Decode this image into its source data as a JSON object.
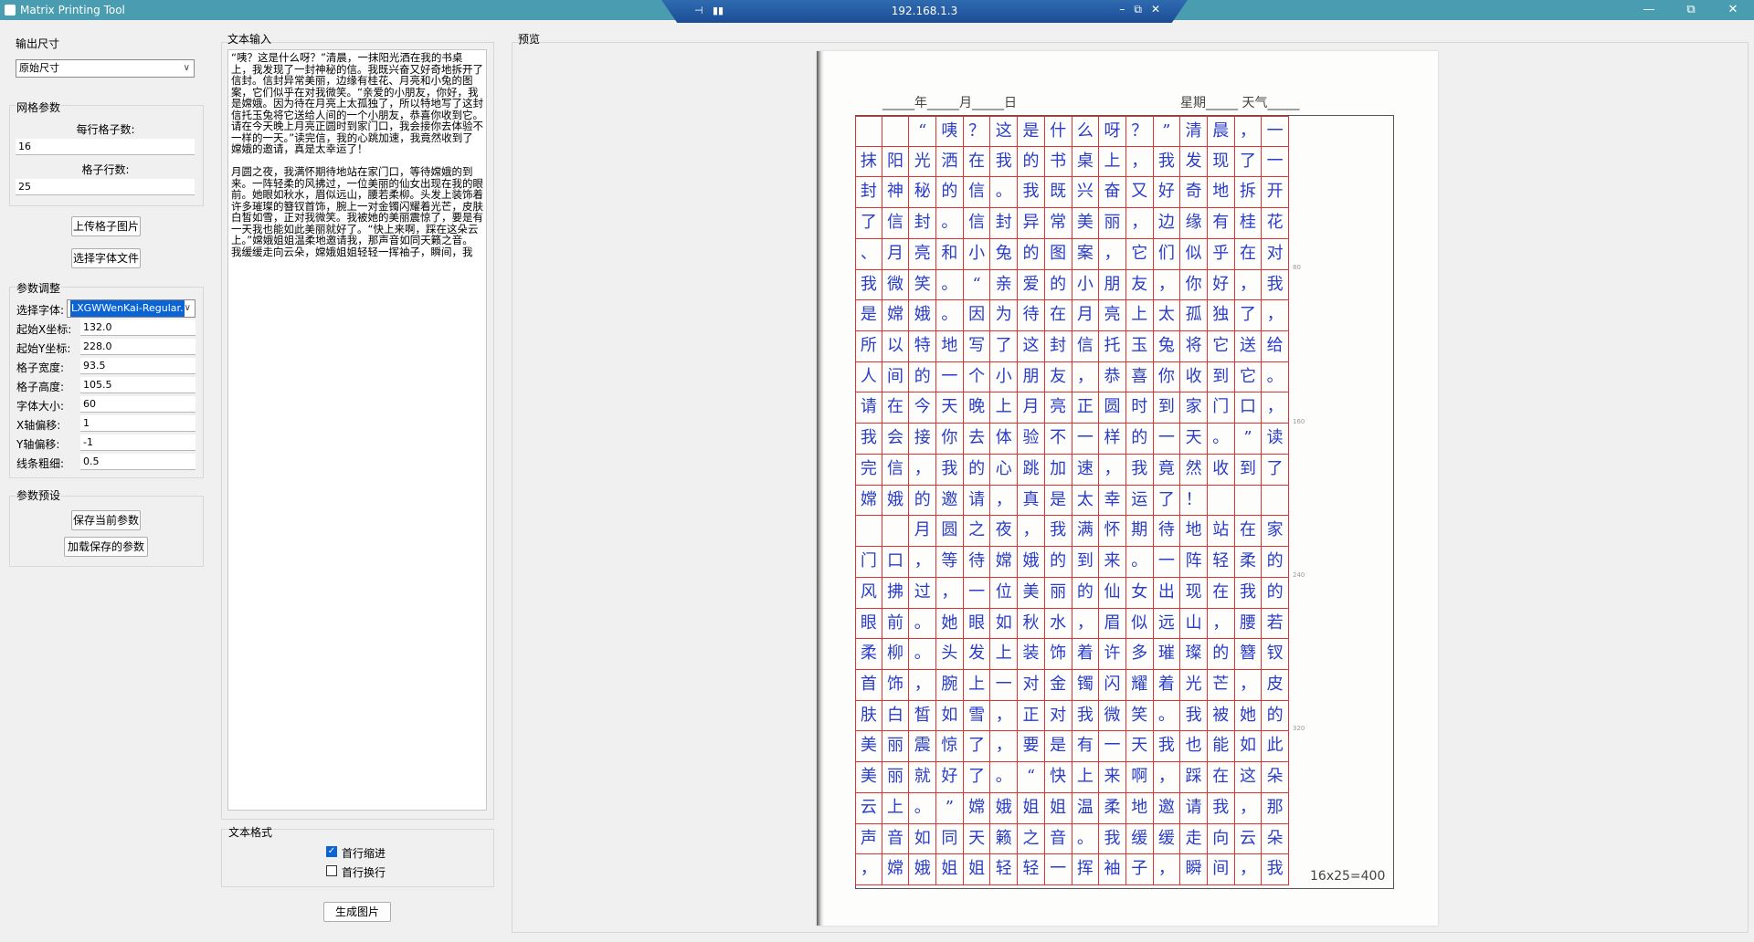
{
  "window": {
    "title": "Matrix Printing Tool",
    "remote_host": "192.168.1.3"
  },
  "output_size": {
    "group_label": "输出尺寸",
    "selected": "原始尺寸"
  },
  "grid_params": {
    "group_label": "网格参数",
    "per_row_label": "每行格子数:",
    "per_row_value": "16",
    "rows_label": "格子行数:",
    "rows_value": "25"
  },
  "buttons": {
    "upload_grid": "上传格子图片",
    "select_font_file": "选择字体文件",
    "save_params": "保存当前参数",
    "load_params": "加载保存的参数",
    "generate": "生成图片"
  },
  "param_adjust": {
    "group_label": "参数调整",
    "rows": [
      {
        "label": "选择字体:",
        "value": "LXGWWenKai-Regular."
      },
      {
        "label": "起始X坐标:",
        "value": "132.0"
      },
      {
        "label": "起始Y坐标:",
        "value": "228.0"
      },
      {
        "label": "格子宽度:",
        "value": "93.5"
      },
      {
        "label": "格子高度:",
        "value": "105.5"
      },
      {
        "label": "字体大小:",
        "value": "60"
      },
      {
        "label": "X轴偏移:",
        "value": "1"
      },
      {
        "label": "Y轴偏移:",
        "value": "-1"
      },
      {
        "label": "线条粗细:",
        "value": "0.5"
      }
    ]
  },
  "presets": {
    "group_label": "参数预设"
  },
  "text_input": {
    "label": "文本输入",
    "content": "“咦？这是什么呀？”清晨，一抹阳光洒在我的书桌上，我发现了一封神秘的信。我既兴奋又好奇地拆开了信封。信封异常美丽，边缘有桂花、月亮和小兔的图案，它们似乎在对我微笑。“亲爱的小朋友，你好，我是嫦娥。因为待在月亮上太孤独了，所以特地写了这封信托玉兔将它送给人间的一个小朋友，恭喜你收到它。请在今天晚上月亮正圆时到家门口，我会接你去体验不一样的一天。”读完信，我的心跳加速，我竟然收到了嫦娥的邀请，真是太幸运了！\n\n月圆之夜，我满怀期待地站在家门口，等待嫦娥的到来。一阵轻柔的风拂过，一位美丽的仙女出现在我的眼前。她眼如秋水，眉似远山，腰若柔柳。头发上装饰着许多璀璨的簪钗首饰，腕上一对金镯闪耀着光芒，皮肤白皙如雪，正对我微笑。我被她的美丽震惊了，要是有一天我也能如此美丽就好了。“快上来啊，踩在这朵云上。”嫦娥姐姐温柔地邀请我，那声音如同天籁之音。我缓缓走向云朵，嫦娥姐姐轻轻一挥袖子，瞬间，我"
  },
  "text_format": {
    "group_label": "文本格式",
    "indent_label": "首行缩进",
    "indent_checked": true,
    "newline_label": "首行换行",
    "newline_checked": false
  },
  "preview": {
    "label": "预览",
    "paper_date": "_____年_____月_____日",
    "paper_week": "星期_____ 天气_____",
    "ticks": [
      "80",
      "160",
      "240",
      "320"
    ],
    "count_text": "16x25=400",
    "grid_text": "  “咦？这是什么呀？”清晨，一抹阳光洒在我的书桌上，我发现了一封神秘的信。我既兴奋又好奇地拆开了信封。信封异常美丽，边缘有桂花、月亮和小兔的图案，它们似乎在对我微笑。“亲爱的小朋友，你好，我是嫦娥。因为待在月亮上太孤独了，所以特地写了这封信托玉兔将它送给人间的一个小朋友，恭喜你收到它。请在今天晚上月亮正圆时到家门口，我会接你去体验不一样的一天。”读完信，我的心跳加速，我竟然收到了嫦娥的邀请，真是太幸运了！     月圆之夜，我满怀期待地站在家门口，等待嫦娥的到来。一阵轻柔的风拂过，一位美丽的仙女出现在我的眼前。她眼如秋水，眉似远山，腰若柔柳。头发上装饰着许多璀璨的簪钗首饰，腕上一对金镯闪耀着光芒，皮肤白皙如雪，正对我微笑。我被她的美丽震惊了，要是有一天我也能如此美丽就好了。“快上来啊，踩在这朵云上。”嫦娥姐姐温柔地邀请我，那声音如同天籁之音。我缓缓走向云朵，嫦娥姐姐轻轻一挥袖子，瞬间，我"
  }
}
